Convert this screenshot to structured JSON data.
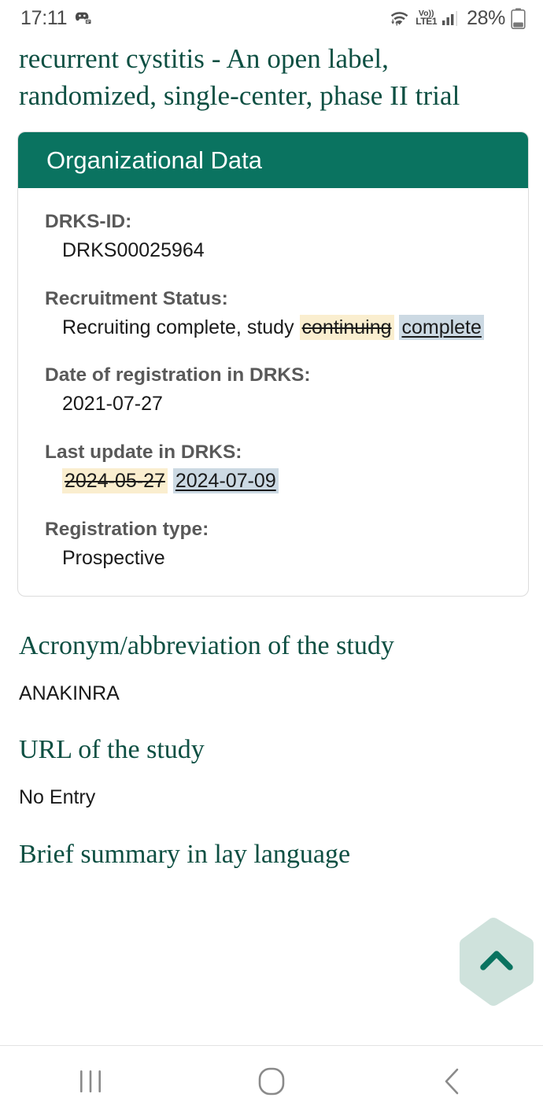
{
  "statusbar": {
    "time": "17:11",
    "app_icon": "game-controller-notification-icon",
    "wifi_icon": "wifi-signal-icon",
    "volte_line1": "Vo))",
    "volte_line2": "LTE1",
    "signal_icon": "cellular-signal-icon",
    "battery_percent": "28%",
    "battery_icon": "battery-icon"
  },
  "page": {
    "title": "recurrent cystitis - An open label, randomized, single-center, phase II trial"
  },
  "card": {
    "header": "Organizational Data",
    "fields": [
      {
        "label": "DRKS-ID:",
        "value": "DRKS00025964"
      },
      {
        "label": "Recruitment Status:",
        "value_prefix": "Recruiting complete, study ",
        "value_old": "continuing",
        "value_new": "complete"
      },
      {
        "label": "Date of registration in DRKS:",
        "value": "2021-07-27"
      },
      {
        "label": "Last update in DRKS:",
        "value_old": "2024-05-27",
        "value_new": "2024-07-09"
      },
      {
        "label": "Registration type:",
        "value": "Prospective"
      }
    ]
  },
  "sections": [
    {
      "heading": "Acronym/abbreviation of the study",
      "body": "ANAKINRA"
    },
    {
      "heading": "URL of the study",
      "body": "No Entry"
    },
    {
      "heading": "Brief summary in lay language",
      "body": ""
    }
  ],
  "scroll_top": {
    "icon": "chevron-up-icon"
  },
  "navbar": {
    "recents": "recents-icon",
    "home": "home-icon",
    "back": "back-icon"
  },
  "colors": {
    "brand_green": "#0a7360",
    "heading_green": "#0d4f42",
    "highlight_old": "#faeecf",
    "highlight_new": "#ccd9e3",
    "hex_fill": "#cfe2dc"
  }
}
